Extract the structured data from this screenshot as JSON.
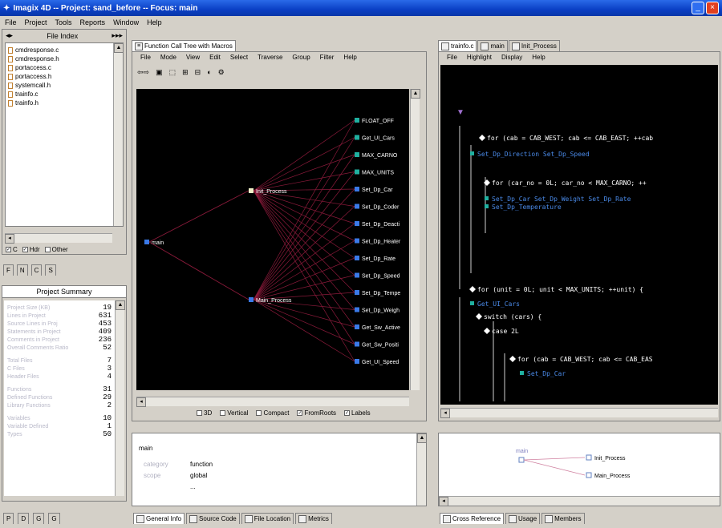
{
  "window": {
    "title": "Imagix 4D  --  Project: sand_before  --  Focus: main"
  },
  "menubar": [
    "File",
    "Project",
    "Tools",
    "Reports",
    "Window",
    "Help"
  ],
  "file_index": {
    "header": "File Index",
    "files": [
      "cmdresponse.c",
      "cmdresponse.h",
      "portaccess.c",
      "portaccess.h",
      "systemcall.h",
      "trainfo.c",
      "trainfo.h"
    ],
    "filters": [
      "C",
      "Hdr",
      "Other"
    ],
    "tabs": [
      "F",
      "N",
      "C",
      "S"
    ]
  },
  "project_summary": {
    "header": "Project Summary",
    "metrics": [
      {
        "label": "Project Size (KB)",
        "value": "19"
      },
      {
        "label": "Lines in Project",
        "value": "631"
      },
      {
        "label": "Source Lines in Proj",
        "value": "453"
      },
      {
        "label": "Statements in Project",
        "value": "409"
      },
      {
        "label": "Comments in Project",
        "value": "236"
      },
      {
        "label": "Overall Comments Ratio",
        "value": "52"
      },
      {
        "label": "Total Files",
        "value": "7"
      },
      {
        "label": "C Files",
        "value": "3"
      },
      {
        "label": "Header Files",
        "value": "4"
      },
      {
        "label": "Functions",
        "value": "31"
      },
      {
        "label": "Defined Functions",
        "value": "29"
      },
      {
        "label": "Library Functions",
        "value": "2"
      },
      {
        "label": "Variables",
        "value": "10"
      },
      {
        "label": "Variable Defined",
        "value": "1"
      },
      {
        "label": "Types",
        "value": "50"
      }
    ],
    "bottom_tabs": [
      "P",
      "D",
      "G",
      "G"
    ]
  },
  "call_tree": {
    "tab": "Function Call Tree with Macros",
    "menu": [
      "File",
      "Mode",
      "View",
      "Edit",
      "Select",
      "Traverse",
      "Group",
      "Filter",
      "Help"
    ],
    "root": "main",
    "mid": [
      "Init_Process",
      "Main_Process"
    ],
    "leaves": [
      "FLOAT_OFF",
      "Get_UI_Cars",
      "MAX_CARNO",
      "MAX_UNITS",
      "Set_Dp_Car",
      "Set_Dp_Coder",
      "Set_Dp_Deacti",
      "Set_Dp_Heater",
      "Set_Dp_Rate",
      "Set_Dp_Speed",
      "Set_Dp_Tempe",
      "Set_Dp_Weigh",
      "Get_Sw_Active",
      "Get_Sw_Positi",
      "Get_UI_Speed"
    ],
    "options": [
      {
        "label": "3D",
        "checked": false
      },
      {
        "label": "Vertical",
        "checked": false
      },
      {
        "label": "Compact",
        "checked": false
      },
      {
        "label": "FromRoots",
        "checked": true
      },
      {
        "label": "Labels",
        "checked": true
      }
    ]
  },
  "info": {
    "name": "main",
    "rows": [
      {
        "k": "category",
        "v": "function"
      },
      {
        "k": "scope",
        "v": "global"
      },
      {
        "k": "",
        "v": "..."
      }
    ],
    "tabs": [
      "General Info",
      "Source Code",
      "File Location",
      "Metrics"
    ]
  },
  "flow": {
    "tabs": [
      "trainfo.c",
      "main",
      "Init_Process"
    ],
    "menu": [
      "File",
      "Highlight",
      "Display",
      "Help"
    ],
    "lines": [
      {
        "t": "for (cab = CAB_WEST; cab <= CAB_EAST; ++cab",
        "c": "w"
      },
      {
        "t": "Set_Dp_Direction  Set_Dp_Speed",
        "c": "b"
      },
      {
        "t": "for (car_no = 0L; car_no < MAX_CARNO; ++",
        "c": "w"
      },
      {
        "t": "Set_Dp_Car  Set_Dp_Weight  Set_Dp_Rate",
        "c": "b"
      },
      {
        "t": "Set_Dp_Temperature",
        "c": "b"
      },
      {
        "t": "for (unit = 0L; unit < MAX_UNITS; ++unit) {",
        "c": "w"
      },
      {
        "t": "Get_UI_Cars",
        "c": "b"
      },
      {
        "t": "switch (cars) {",
        "c": "w"
      },
      {
        "t": "case 2L",
        "c": "w"
      },
      {
        "t": "for (cab = CAB_WEST; cab <= CAB_EAS",
        "c": "w"
      },
      {
        "t": "Set_Dp_Car",
        "c": "b"
      }
    ]
  },
  "xref": {
    "root": "main",
    "children": [
      "Init_Process",
      "Main_Process"
    ],
    "tabs": [
      "Cross Reference",
      "Usage",
      "Members"
    ]
  }
}
